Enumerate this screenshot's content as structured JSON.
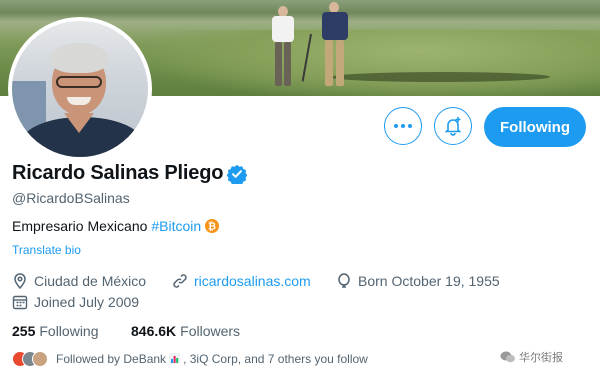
{
  "profile": {
    "display_name": "Ricardo Salinas Pliego",
    "handle": "@RicardoBSalinas",
    "bio_text": "Empresario Mexicano",
    "bio_hashtag": "#Bitcoin",
    "translate_link": "Translate bio",
    "location": "Ciudad de México",
    "website": "ricardosalinas.com",
    "birth": "Born October 19, 1955",
    "joined": "Joined July 2009"
  },
  "counts": {
    "following_value": "255",
    "following_label": "Following",
    "followers_value": "846.6K",
    "followers_label": "Followers"
  },
  "actions": {
    "follow_label": "Following",
    "more_icon": "more-icon",
    "notify_icon": "notification-add-icon"
  },
  "followed_by": {
    "prefix": "Followed by DeBank",
    "suffix": ", 3iQ Corp, and 7 others you follow"
  },
  "watermark": "华尔街报",
  "colors": {
    "accent": "#1d9bf0",
    "text_primary": "#0f1419",
    "text_secondary": "#536471",
    "bitcoin": "#f7931a"
  }
}
